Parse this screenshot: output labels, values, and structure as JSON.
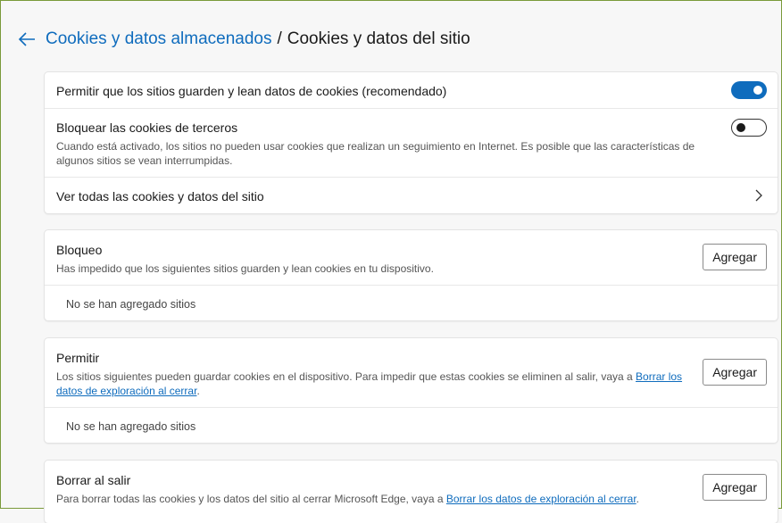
{
  "breadcrumb": {
    "parent": "Cookies y datos almacenados",
    "separator": "/",
    "current": "Cookies y datos del sitio"
  },
  "settings": {
    "allow_cookies": {
      "title": "Permitir que los sitios guarden y lean datos de cookies (recomendado)",
      "enabled": true
    },
    "block_third_party": {
      "title": "Bloquear las cookies de terceros",
      "description": "Cuando está activado, los sitios no pueden usar cookies que realizan un seguimiento en Internet. Es posible que las características de algunos sitios se vean interrumpidas.",
      "enabled": false
    },
    "see_all": {
      "title": "Ver todas las cookies y datos del sitio"
    }
  },
  "block": {
    "title": "Bloqueo",
    "description": "Has impedido que los siguientes sitios guarden y lean cookies en tu dispositivo.",
    "button": "Agregar",
    "empty": "No se han agregado sitios"
  },
  "allow": {
    "title": "Permitir",
    "description_prefix": "Los sitios siguientes pueden guardar cookies en el dispositivo. Para impedir que estas cookies se eliminen al salir, vaya a ",
    "link": "Borrar los datos de exploración al cerrar",
    "description_suffix": ".",
    "button": "Agregar",
    "empty": "No se han agregado sitios"
  },
  "clear_on_exit": {
    "title": "Borrar al salir",
    "description_prefix": "Para borrar todas las cookies y los datos del sitio al cerrar Microsoft Edge, vaya a ",
    "link": "Borrar los datos de exploración al cerrar",
    "description_suffix": ".",
    "button": "Agregar"
  },
  "colors": {
    "accent": "#0f6cbd",
    "card_bg": "#ffffff",
    "page_bg": "#f7f7f7"
  },
  "icons": {
    "back": "back-arrow-icon",
    "chevron": "chevron-right-icon"
  }
}
